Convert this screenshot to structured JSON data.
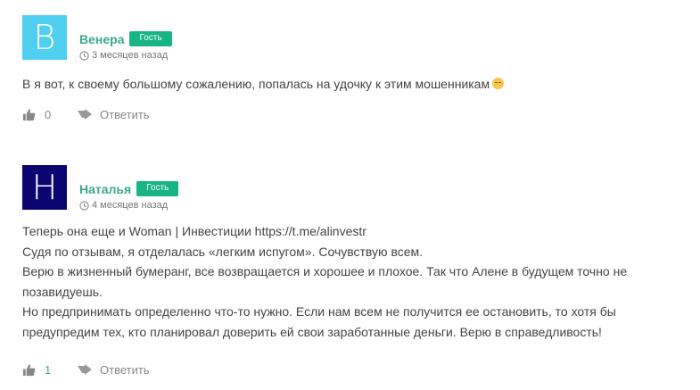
{
  "comments": [
    {
      "avatar_letter": "B",
      "avatar_color": "#4fd0f0",
      "author": "Венера",
      "badge": "Гость",
      "date": "3 месяцев назад",
      "lines": [
        "В я вот, к своему большому сожалению, попалась на удочку к этим мошенникам"
      ],
      "emoji": "sad-face-emoji",
      "likes": "0",
      "reply": "Ответить"
    },
    {
      "avatar_letter": "H",
      "avatar_color": "#0a0570",
      "author": "Наталья",
      "badge": "Гость",
      "date": "4 месяцев назад",
      "lines": [
        "Теперь она еще и Woman | Инвестиции https://t.me/alinvestr",
        "Судя по отзывам, я отделалась «легким испугом». Сочувствую всем.",
        "Верю в жизненный бумеранг, все возвращается и хорошее и плохое. Так что Алене в будущем точно не",
        "позавидуешь.",
        "Но предпринимать определенно что-то нужно. Если нам всем не получится ее остановить, то хотя бы",
        "предупредим тех, кто планировал доверить ей свои заработанные деньги. Верю в справедливость!"
      ],
      "likes": "1",
      "reply": "Ответить"
    }
  ],
  "colors": {
    "accent": "#3aaa8c",
    "badge": "#17b486",
    "muted": "#888888"
  }
}
